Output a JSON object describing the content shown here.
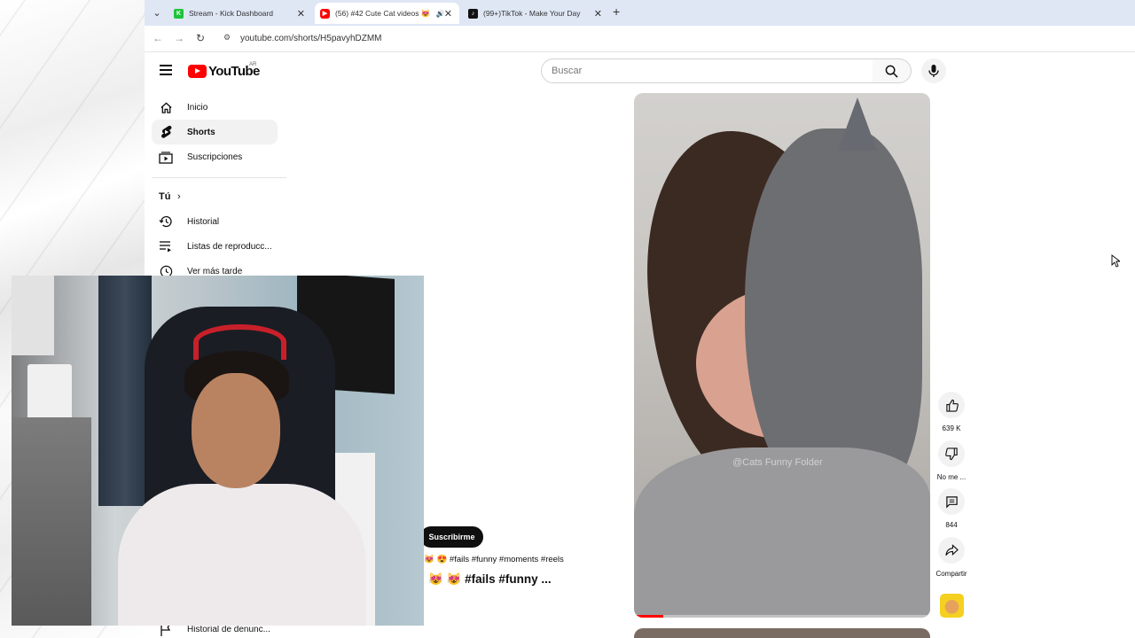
{
  "browser": {
    "tabs": [
      {
        "title": "Stream - Kick Dashboard",
        "favicon_color": "#1ec43b",
        "favicon_letter": "K",
        "active": false
      },
      {
        "title": "(56) #42 Cute Cat videos 😻",
        "favicon_color": "#ff0000",
        "favicon_letter": "▶",
        "active": true,
        "audio": true
      },
      {
        "title": "(99+)TikTok - Make Your Day",
        "favicon_color": "#111111",
        "favicon_letter": "♪",
        "active": false
      }
    ],
    "url": "youtube.com/shorts/H5pavyhDZMM"
  },
  "youtube": {
    "logo_text": "YouTube",
    "country_code": "AR",
    "search_placeholder": "Buscar",
    "brand_color": "#ff0000"
  },
  "sidebar": {
    "items": [
      {
        "label": "Inicio",
        "icon": "home-icon"
      },
      {
        "label": "Shorts",
        "icon": "shorts-icon",
        "active": true
      },
      {
        "label": "Suscripciones",
        "icon": "subscriptions-icon"
      }
    ],
    "you_header": "Tú",
    "you_items": [
      {
        "label": "Historial",
        "icon": "history-icon"
      },
      {
        "label": "Listas de reproducc...",
        "icon": "playlist-icon"
      },
      {
        "label": "Ver más tarde",
        "icon": "clock-icon"
      }
    ],
    "bottom_item": {
      "label": "Historial de denunc...",
      "icon": "flag-icon"
    }
  },
  "short": {
    "watermark": "@Cats Funny Folder",
    "subscribe_label": "Suscribirme",
    "description": "😻 😍 #fails #funny #moments #reels",
    "title": "😻 😻 #fails #funny ...",
    "progress_fraction": 0.1
  },
  "actions": {
    "like_count": "639 K",
    "dislike_label": "No me ...",
    "comment_count": "844",
    "share_label": "Compartir"
  }
}
